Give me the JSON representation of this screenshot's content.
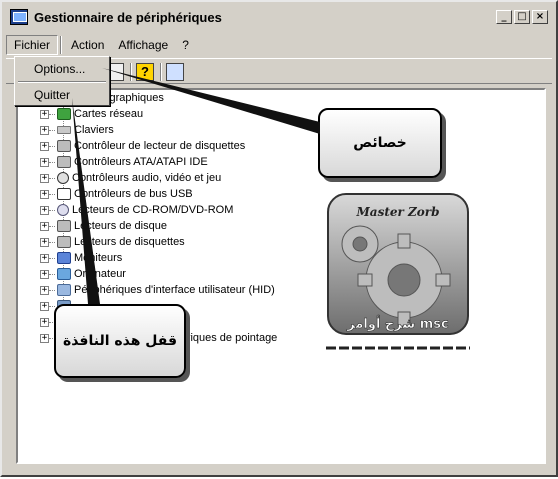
{
  "window": {
    "title": "Gestionnaire de périphériques",
    "controls": [
      "_",
      "□",
      "×"
    ]
  },
  "menu": {
    "items": [
      "Fichier",
      "Action",
      "Affichage",
      "?"
    ],
    "active": "Fichier"
  },
  "dropdown": {
    "options": "Options...",
    "quitter": "Quitter"
  },
  "tree": {
    "items": [
      {
        "label": "Cartes graphiques",
        "icon": "display-adapter-icon"
      },
      {
        "label": "Cartes réseau",
        "icon": "network-card-icon"
      },
      {
        "label": "Claviers",
        "icon": "keyboard-icon"
      },
      {
        "label": "Contrôleur de lecteur de disquettes",
        "icon": "floppy-controller-icon"
      },
      {
        "label": "Contrôleurs ATA/ATAPI IDE",
        "icon": "ide-controller-icon"
      },
      {
        "label": "Contrôleurs audio, vidéo et jeu",
        "icon": "sound-icon"
      },
      {
        "label": "Contrôleurs de bus USB",
        "icon": "usb-icon"
      },
      {
        "label": "Lecteurs de CD-ROM/DVD-ROM",
        "icon": "cdrom-icon"
      },
      {
        "label": "Lecteurs de disque",
        "icon": "disk-drive-icon"
      },
      {
        "label": "Lecteurs de disquettes",
        "icon": "floppy-drive-icon"
      },
      {
        "label": "Moniteurs",
        "icon": "monitor-icon"
      },
      {
        "label": "Ordinateur",
        "icon": "computer-icon"
      },
      {
        "label": "Périphériques d'interface utilisateur (HID)",
        "icon": "hid-icon"
      },
      {
        "label": "",
        "icon": "device-icon"
      },
      {
        "label": "",
        "icon": "device-icon"
      },
      {
        "label": "Souris et autres périphériques de pointage",
        "icon": "mouse-icon"
      }
    ]
  },
  "annotations": {
    "properties": "خصائص",
    "close_window": "قفل هذه النافذة"
  },
  "logo": {
    "top_text": "Master Zorb",
    "bottom_text": "شرح أوامر msc"
  }
}
